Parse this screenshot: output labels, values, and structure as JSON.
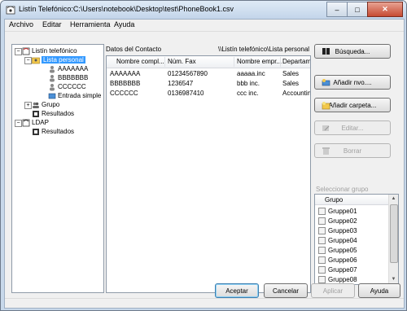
{
  "window": {
    "title": "Listín Telefónico:C:\\Users\\notebook\\Desktop\\test\\PhoneBook1.csv",
    "controls": {
      "minimize": "‒",
      "maximize": "□",
      "close": "✕"
    }
  },
  "menu": [
    {
      "label": "Archivo",
      "accel": "A"
    },
    {
      "label": "Editar",
      "accel": "E"
    },
    {
      "label": "Herramienta",
      "accel": "H"
    },
    {
      "label": "Ayuda",
      "accel": "y"
    }
  ],
  "tree": {
    "root": "Listín telefónico",
    "list": "Lista personal",
    "contacts": [
      "AAAAAAA",
      "BBBBBBB",
      "CCCCCC"
    ],
    "simple": "Entrada simple",
    "group": "Grupo",
    "results": "Resultados",
    "ldap": "LDAP",
    "ldap_results": "Resultados",
    "expander_minus": "−",
    "expander_plus": "+"
  },
  "main": {
    "data_label": "Datos del Contacto",
    "path": "\\\\Listín telefónico\\Lista personal",
    "columns": [
      "Nombre compl...",
      "Núm. Fax",
      "Nombre empr...",
      "Departame"
    ],
    "rows": [
      [
        "AAAAAAA",
        "01234567890",
        "aaaaa.inc",
        "Sales"
      ],
      [
        "BBBBBBB",
        "1236547",
        "bbb inc.",
        "Sales"
      ],
      [
        "CCCCCC",
        "0136987410",
        "ccc inc.",
        "Accounting"
      ]
    ]
  },
  "buttons": {
    "search": "Búsqueda...",
    "add_new": "Añadir nvo....",
    "add_folder": "Añadir carpeta...",
    "edit": "Editar...",
    "delete": "Borrar"
  },
  "group_select": {
    "label": "Seleccionar grupo",
    "header": "Grupo",
    "items": [
      "Gruppe01",
      "Gruppe02",
      "Gruppe03",
      "Gruppe04",
      "Gruppe05",
      "Gruppe06",
      "Gruppe07",
      "Gruppe08"
    ]
  },
  "footer": {
    "accept": "Aceptar",
    "cancel": "Cancelar",
    "apply": "Aplicar",
    "help": "Ayuda"
  },
  "colors": {
    "selection": "#3399ff",
    "title_gradient_top": "#dfeaf6",
    "close_button": "#c64a32"
  }
}
